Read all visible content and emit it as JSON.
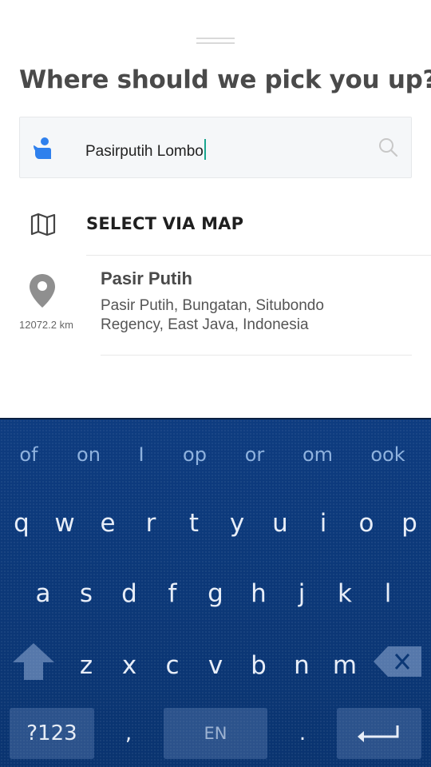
{
  "sheet": {
    "title": "Where should we pick you up?",
    "search": {
      "value": "Pasirputih Lombo",
      "icon": "pickup-person-icon",
      "search_icon": "search-icon"
    },
    "map_option": {
      "label": "SELECT VIA MAP",
      "icon": "map-icon"
    },
    "results": [
      {
        "title": "Pasir Putih",
        "address": "Pasir Putih, Bungatan, Situbondo Regency, East Java, Indonesia",
        "distance": "12072.2 km",
        "icon": "location-pin-icon"
      }
    ]
  },
  "keyboard": {
    "suggestions": [
      "of",
      "on",
      "I",
      "op",
      "or",
      "om",
      "ook"
    ],
    "row1": [
      "q",
      "w",
      "e",
      "r",
      "t",
      "y",
      "u",
      "i",
      "o",
      "p"
    ],
    "row2": [
      "a",
      "s",
      "d",
      "f",
      "g",
      "h",
      "j",
      "k",
      "l"
    ],
    "row3": [
      "z",
      "x",
      "c",
      "v",
      "b",
      "n",
      "m"
    ],
    "symbols_label": "?123",
    "comma": ",",
    "space_label": "EN",
    "period": ".",
    "colors": {
      "background": "#0b3775",
      "suggestion": "#8fb2de",
      "key_text": "#e8eef8"
    }
  },
  "colors": {
    "accent_icon": "#2f80ed",
    "caret": "#1aa68f",
    "title": "#4a4a4a"
  }
}
